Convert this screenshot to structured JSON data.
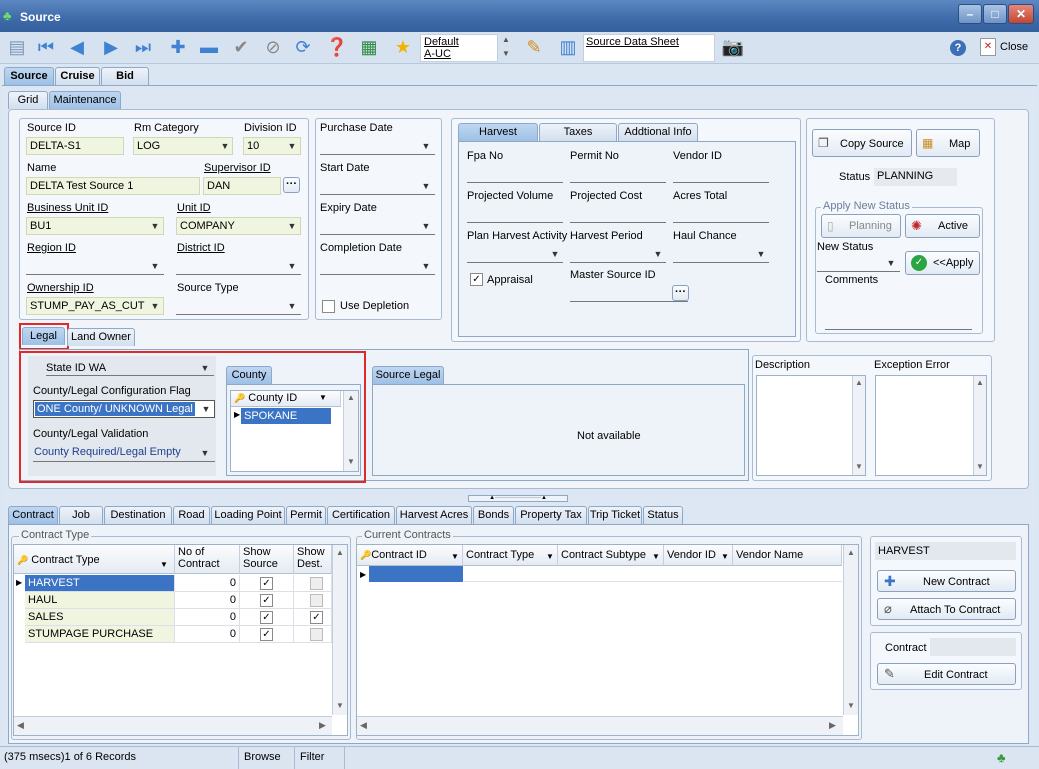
{
  "window": {
    "title": "Source"
  },
  "toolbar": {
    "default_label": "Default",
    "auc_label": "A-UC",
    "sheet_label": "Source Data Sheet",
    "close_label": "Close"
  },
  "top_tabs": [
    "Source",
    "Cruise",
    "Bid"
  ],
  "sub_tabs": [
    "Grid",
    "Maintenance"
  ],
  "form": {
    "source_id_label": "Source ID",
    "source_id": "DELTA-S1",
    "rm_category_label": "Rm Category",
    "rm_category": "LOG",
    "division_id_label": "Division ID",
    "division_id": "10",
    "name_label": "Name",
    "name": "DELTA Test Source 1",
    "supervisor_id_label": "Supervisor ID",
    "supervisor_id": "DAN",
    "business_unit_label": "Business Unit ID",
    "business_unit": "BU1",
    "unit_id_label": "Unit ID",
    "unit_id": "COMPANY",
    "region_id_label": "Region ID",
    "district_id_label": "District ID",
    "ownership_id_label": "Ownership ID",
    "ownership_id": "STUMP_PAY_AS_CUT",
    "source_type_label": "Source Type",
    "purchase_date_label": "Purchase Date",
    "start_date_label": "Start Date",
    "expiry_date_label": "Expiry Date",
    "completion_date_label": "Completion Date",
    "use_depletion_label": "Use Depletion"
  },
  "harvest_tabs": [
    "Harvest",
    "Taxes",
    "Addtional Info"
  ],
  "harvest": {
    "fpa_no": "Fpa No",
    "permit_no": "Permit No",
    "vendor_id": "Vendor ID",
    "projected_volume": "Projected Volume",
    "projected_cost": "Projected Cost",
    "acres_total": "Acres Total",
    "plan_harvest_activity": "Plan Harvest Activity",
    "harvest_period": "Harvest Period",
    "haul_chance": "Haul Chance",
    "appraisal": "Appraisal",
    "master_source_id": "Master Source ID"
  },
  "right_panel": {
    "copy_source": "Copy Source",
    "map": "Map",
    "status_label": "Status",
    "status_value": "PLANNING",
    "apply_new_status": "Apply New Status",
    "planning": "Planning",
    "active": "Active",
    "new_status": "New Status",
    "apply": "<<Apply",
    "comments": "Comments"
  },
  "legal_tabs": [
    "Legal",
    "Land Owner"
  ],
  "legal": {
    "state_id": "State ID WA",
    "config_flag_label": "County/Legal Configuration Flag",
    "config_flag_value": "ONE County/ UNKNOWN Legal",
    "validation_label": "County/Legal Validation",
    "validation_value": "County Required/Legal Empty",
    "county_tab": "County",
    "county_col": "County ID",
    "county_row": "SPOKANE",
    "source_legal_tab": "Source Legal",
    "not_available": "Not available",
    "description": "Description",
    "exception_error": "Exception Error"
  },
  "bottom_tabs": [
    "Contract",
    "Job",
    "Destination",
    "Road",
    "Loading Point",
    "Permit",
    "Certification",
    "Harvest Acres",
    "Bonds",
    "Property Tax",
    "Trip Ticket",
    "Status"
  ],
  "contract_type": {
    "group_label": "Contract Type",
    "columns": [
      "Contract Type",
      "No of Contract",
      "Show Source",
      "Show Dest."
    ],
    "rows": [
      {
        "type": "HARVEST",
        "count": "0",
        "show_source": true,
        "show_dest": false
      },
      {
        "type": "HAUL",
        "count": "0",
        "show_source": true,
        "show_dest": false
      },
      {
        "type": "SALES",
        "count": "0",
        "show_source": true,
        "show_dest": true
      },
      {
        "type": "STUMPAGE PURCHASE",
        "count": "0",
        "show_source": true,
        "show_dest": false
      }
    ]
  },
  "current_contracts": {
    "group_label": "Current Contracts",
    "columns": [
      "Contract ID",
      "Contract Type",
      "Contract Subtype",
      "Vendor ID",
      "Vendor Name"
    ]
  },
  "contract_actions": {
    "harvest_label": "HARVEST",
    "new_contract": "New Contract",
    "attach_to_contract": "Attach To Contract",
    "contract_label": "Contract",
    "edit_contract": "Edit Contract"
  },
  "statusbar": {
    "records": "(375 msecs)1 of 6 Records",
    "mode": "Browse",
    "filter": "Filter"
  }
}
